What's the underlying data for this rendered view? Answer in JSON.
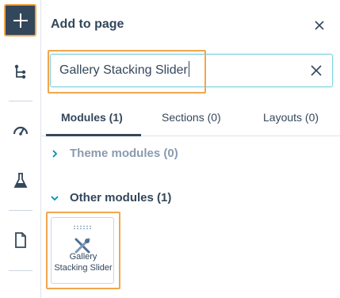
{
  "colors": {
    "dark": "#33475b",
    "accent_outline": "#f2a64d",
    "focus": "#7fd1de",
    "muted": "#8a9bb0"
  },
  "rail": {
    "items": [
      {
        "icon": "plus-icon"
      },
      {
        "icon": "tree-structure-icon"
      },
      {
        "icon": "speedometer-icon"
      },
      {
        "icon": "flask-icon"
      },
      {
        "icon": "document-icon"
      }
    ]
  },
  "panel": {
    "title": "Add to page",
    "search_value": "Gallery Stacking Slider",
    "tabs": [
      {
        "label": "Modules (1)",
        "active": true
      },
      {
        "label": "Sections (0)",
        "active": false
      },
      {
        "label": "Layouts (0)",
        "active": false
      }
    ],
    "groups": [
      {
        "label": "Theme modules (0)",
        "expanded": false
      },
      {
        "label": "Other modules (1)",
        "expanded": true
      }
    ],
    "module": {
      "label": "Gallery Stacking Slider",
      "icon": "tools-icon"
    }
  }
}
